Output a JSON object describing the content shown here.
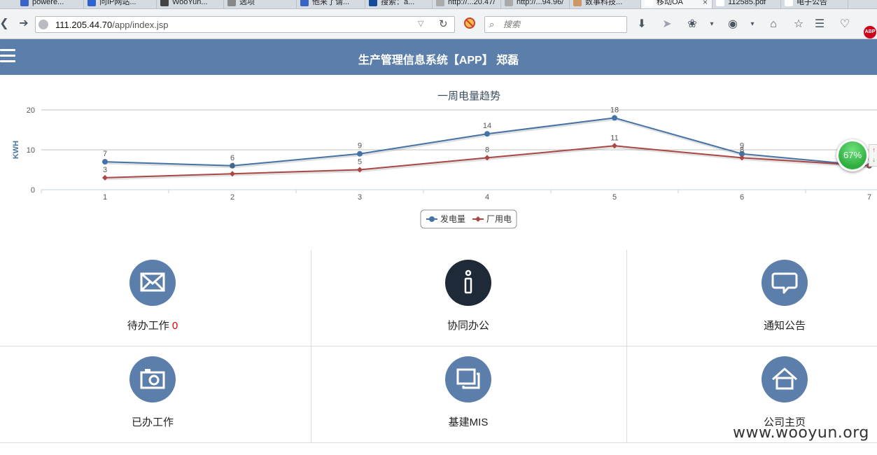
{
  "browser": {
    "tabs": [
      {
        "label": "powere...",
        "active": false
      },
      {
        "label": "问IP网站...",
        "active": false
      },
      {
        "label": "WooYun...",
        "active": false
      },
      {
        "label": "选项",
        "active": false
      },
      {
        "label": "他来了请...",
        "active": false
      },
      {
        "label": "搜索：a...",
        "active": false
      },
      {
        "label": "http://...20.47/",
        "active": false
      },
      {
        "label": "http://...94.96/",
        "active": false
      },
      {
        "label": "数事科技...",
        "active": false
      },
      {
        "label": "移动OA",
        "active": true
      },
      {
        "label": "112585.pdf",
        "active": false
      },
      {
        "label": "电子公告",
        "active": false
      }
    ],
    "url_host": "111.205.44.70",
    "url_path": "/app/index.jsp",
    "search_placeholder": "搜索",
    "abp_label": "ABP"
  },
  "header": {
    "title": "生产管理信息系统【APP】 郑磊"
  },
  "chart_data": {
    "type": "line",
    "title": "一周电量趋势",
    "ylabel": "KWH",
    "xlabel": "",
    "categories": [
      "1",
      "2",
      "3",
      "4",
      "5",
      "6",
      "7"
    ],
    "ylim": [
      0,
      20
    ],
    "yticks": [
      0,
      10,
      20
    ],
    "grid": true,
    "legend_position": "bottom",
    "series": [
      {
        "name": "发电量",
        "values": [
          7,
          6,
          9,
          14,
          18,
          9,
          6
        ],
        "color": "#4572a7"
      },
      {
        "name": "厂用电",
        "values": [
          3,
          4,
          5,
          8,
          11,
          8,
          6
        ],
        "color": "#aa4643"
      }
    ]
  },
  "tiles": [
    {
      "label": "待办工作",
      "badge": "0",
      "icon": "envelope-icon"
    },
    {
      "label": "协同办公",
      "badge": "",
      "icon": "info-icon"
    },
    {
      "label": "通知公告",
      "badge": "",
      "icon": "speech-bubble-icon"
    },
    {
      "label": "已办工作",
      "badge": "",
      "icon": "camera-icon"
    },
    {
      "label": "基建MIS",
      "badge": "",
      "icon": "windows-icon"
    },
    {
      "label": "公司主页",
      "badge": "",
      "icon": "home-icon"
    }
  ],
  "speed_widget": {
    "value": "67%"
  },
  "watermark": "www.wooyun.org",
  "colors": {
    "header_bg": "#5b7eab",
    "tile_circle": "#5b7eab",
    "tile_circle_dark": "#1f2a38",
    "badge": "#e60000"
  }
}
